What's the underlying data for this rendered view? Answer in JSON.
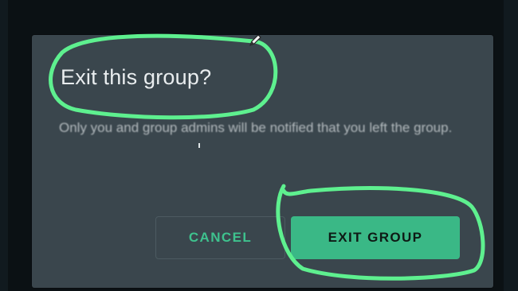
{
  "dialog": {
    "title": "Exit this group?",
    "message": "Only you and group admins will be notified that you left the group.",
    "cancel_label": "CANCEL",
    "exit_label": "EXIT GROUP"
  },
  "colors": {
    "dialog_background": "#3a464d",
    "accent": "#3ab886",
    "cancel_text": "#3ec28e",
    "annotation_stroke": "#5ef08f"
  },
  "icons": {
    "pencil": "pencil-icon"
  }
}
